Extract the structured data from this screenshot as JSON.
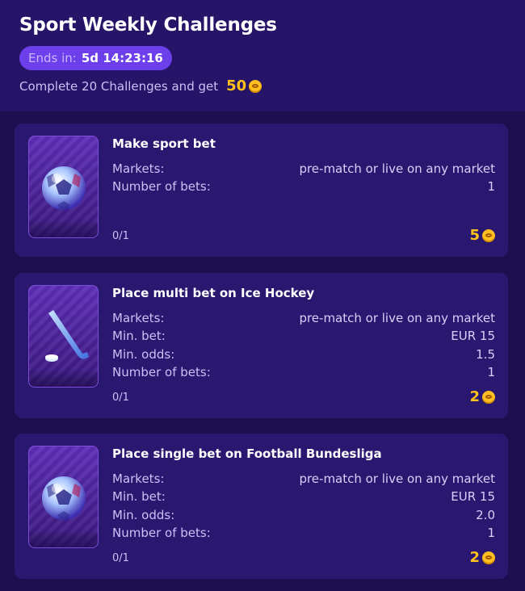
{
  "header": {
    "title": "Sport Weekly Challenges",
    "timer_label": "Ends in:",
    "timer_value": "5d 14:23:16",
    "goal_text": "Complete 20 Challenges and get",
    "goal_amount": "50",
    "coin_icon": "coin-icon"
  },
  "challenges": [
    {
      "title": "Make sport bet",
      "icon": "soccer-ball-icon",
      "rows": [
        {
          "label": "Markets:",
          "value": "pre-match or live on any market"
        },
        {
          "label": "Number of bets:",
          "value": "1"
        }
      ],
      "progress": "0/1",
      "reward": "5"
    },
    {
      "title": "Place multi bet on Ice Hockey",
      "icon": "hockey-stick-icon",
      "rows": [
        {
          "label": "Markets:",
          "value": "pre-match or live on any market"
        },
        {
          "label": "Min. bet:",
          "value": "EUR 15"
        },
        {
          "label": "Min. odds:",
          "value": "1.5"
        },
        {
          "label": "Number of bets:",
          "value": "1"
        }
      ],
      "progress": "0/1",
      "reward": "2"
    },
    {
      "title": "Place single bet on Football Bundesliga",
      "icon": "soccer-ball-icon",
      "rows": [
        {
          "label": "Markets:",
          "value": "pre-match or live on any market"
        },
        {
          "label": "Min. bet:",
          "value": "EUR 15"
        },
        {
          "label": "Min. odds:",
          "value": "2.0"
        },
        {
          "label": "Number of bets:",
          "value": "1"
        }
      ],
      "progress": "0/1",
      "reward": "2"
    }
  ],
  "colors": {
    "background": "#1c0f4f",
    "card": "#2a1770",
    "accent": "#6c3fea",
    "coin": "#ffc21a"
  }
}
